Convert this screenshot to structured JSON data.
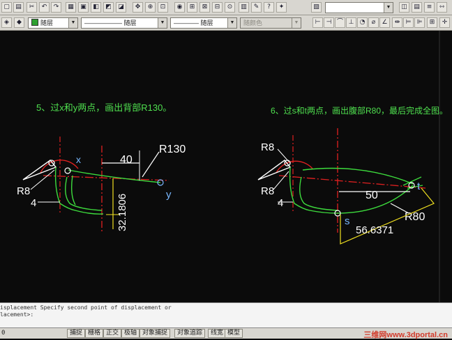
{
  "layer_combo": {
    "value": "随层"
  },
  "linetype_combo": {
    "value": "随层"
  },
  "lineweight_combo": {
    "value": "随层"
  },
  "color_combo": {
    "value": "随颜色"
  },
  "drawing": {
    "step5_caption": "5、过x和y两点，画出背部R130。",
    "step6_caption": "6、过s和t两点，画出腹部R80，最后完成全图。",
    "left": {
      "label_x": "x",
      "label_y": "y",
      "dim_40": "40",
      "dim_r130": "R130",
      "dim_r8": "R8",
      "dim_4": "4",
      "dim_vertical": "32.1806"
    },
    "right": {
      "label_s": "s",
      "label_t": "t",
      "dim_r8": "R8",
      "dim_4": "4",
      "dim_50": "50",
      "dim_r80": "R80",
      "dim_arc": "56.6371"
    }
  },
  "command": {
    "line1": "isplacement  Specify second point of displacement or",
    "line2": "lacement>:",
    "line3": "0"
  },
  "status": {
    "snap": "捕捉",
    "grid": "栅格",
    "ortho": "正交",
    "polar": "极轴",
    "osnap": "对象捕捉",
    "otrack": "对象追踪",
    "lwt": "线宽",
    "model": "模型"
  },
  "watermark": "三维网www.3dportal.cn",
  "colors": {
    "canvas_bg": "#0b0b0b",
    "caption_green": "#4fe04f",
    "outline_green": "#3ddc3d",
    "center_red": "#e02020",
    "dim_white": "#ffffff",
    "label_cyan": "#7ab8ff",
    "dim_yellow": "#f0e020",
    "toolbar_gray": "#d8d6d0",
    "watermark_red": "#d23a2a"
  }
}
